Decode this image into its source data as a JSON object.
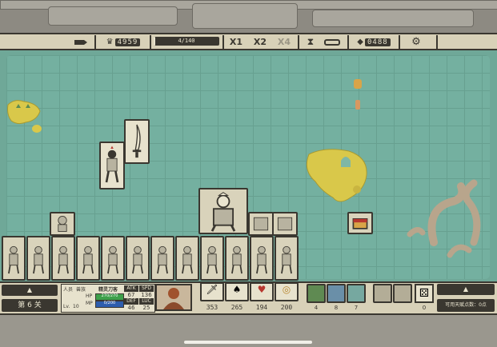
{
  "hud_top": {
    "gold": "4959",
    "progress_text": "4/140",
    "progress_value": 0.03,
    "speed_options": [
      "X1",
      "X2",
      "X4"
    ],
    "gems": "0488"
  },
  "hud_bottom": {
    "level_label": "第 6 关",
    "unit_name": "精灵刀客",
    "unit_header": "人员",
    "unit_type": "兽族",
    "hp_label": "HP",
    "hp_value": "270/270",
    "mp_label": "MP",
    "mp_value": "0/200",
    "stats_headers": [
      "ATK",
      "SPD",
      "DEF",
      "LUC"
    ],
    "stats_values": [
      "67",
      "136",
      "46",
      "25"
    ],
    "lv_label": "Lv.",
    "lv_value": "10",
    "resources": [
      "353",
      "265",
      "194",
      "200"
    ],
    "slot_counts": [
      "4",
      "8",
      "7"
    ],
    "dice_count": "0",
    "talent_text": "可用天赋点数：0点"
  },
  "colors": {
    "water": "#74b0a0",
    "panel": "#d8d1b8",
    "outline": "#3a3730",
    "island": "#d9c84a"
  }
}
